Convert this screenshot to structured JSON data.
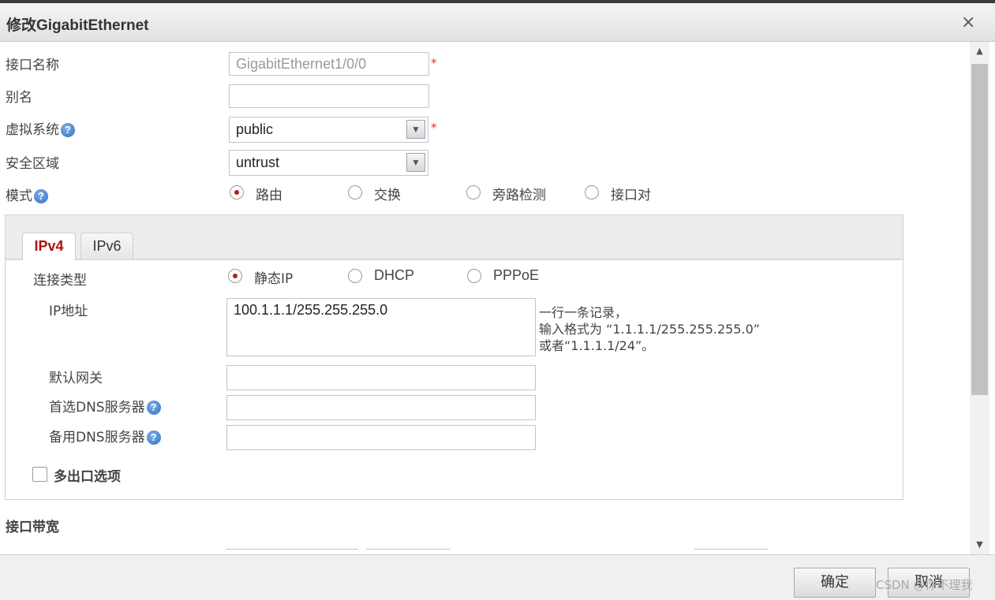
{
  "dialog": {
    "title": "修改GigabitEthernet",
    "close_glyph": "×"
  },
  "form": {
    "interface_name": {
      "label": "接口名称",
      "value": "GigabitEthernet1/0/0",
      "required": "*"
    },
    "alias": {
      "label": "别名",
      "value": ""
    },
    "virtual_system": {
      "label": "虚拟系统",
      "value": "public",
      "required": "*"
    },
    "security_zone": {
      "label": "安全区域",
      "value": "untrust"
    },
    "mode": {
      "label": "模式",
      "options": [
        "路由",
        "交换",
        "旁路检测",
        "接口对"
      ],
      "selected": "路由"
    }
  },
  "tabs": [
    {
      "label": "IPv4",
      "active": true
    },
    {
      "label": "IPv6",
      "active": false
    }
  ],
  "ipv4": {
    "connection_type": {
      "label": "连接类型",
      "options": [
        "静态IP",
        "DHCP",
        "PPPoE"
      ],
      "selected": "静态IP"
    },
    "ip_address": {
      "label": "IP地址",
      "value": "100.1.1.1/255.255.255.0",
      "hint": "一行一条记录，\n输入格式为 “1.1.1.1/255.255.255.0”\n或者“1.1.1.1/24”。"
    },
    "default_gateway": {
      "label": "默认网关",
      "value": ""
    },
    "primary_dns": {
      "label": "首选DNS服务器",
      "value": ""
    },
    "secondary_dns": {
      "label": "备用DNS服务器",
      "value": ""
    },
    "multi_egress": {
      "label": "多出口选项",
      "checked": false
    }
  },
  "bandwidth_section": {
    "label": "接口带宽"
  },
  "help_glyph": "?",
  "scroll": {
    "up": "▲",
    "down": "▼"
  },
  "footer": {
    "ok_label": "确定",
    "cancel_label": "取消"
  },
  "watermark": "CSDN @你不理我",
  "colors": {
    "accent_red": "#b01010",
    "required_red": "#e23030",
    "help_blue": "#2f6fc2"
  }
}
